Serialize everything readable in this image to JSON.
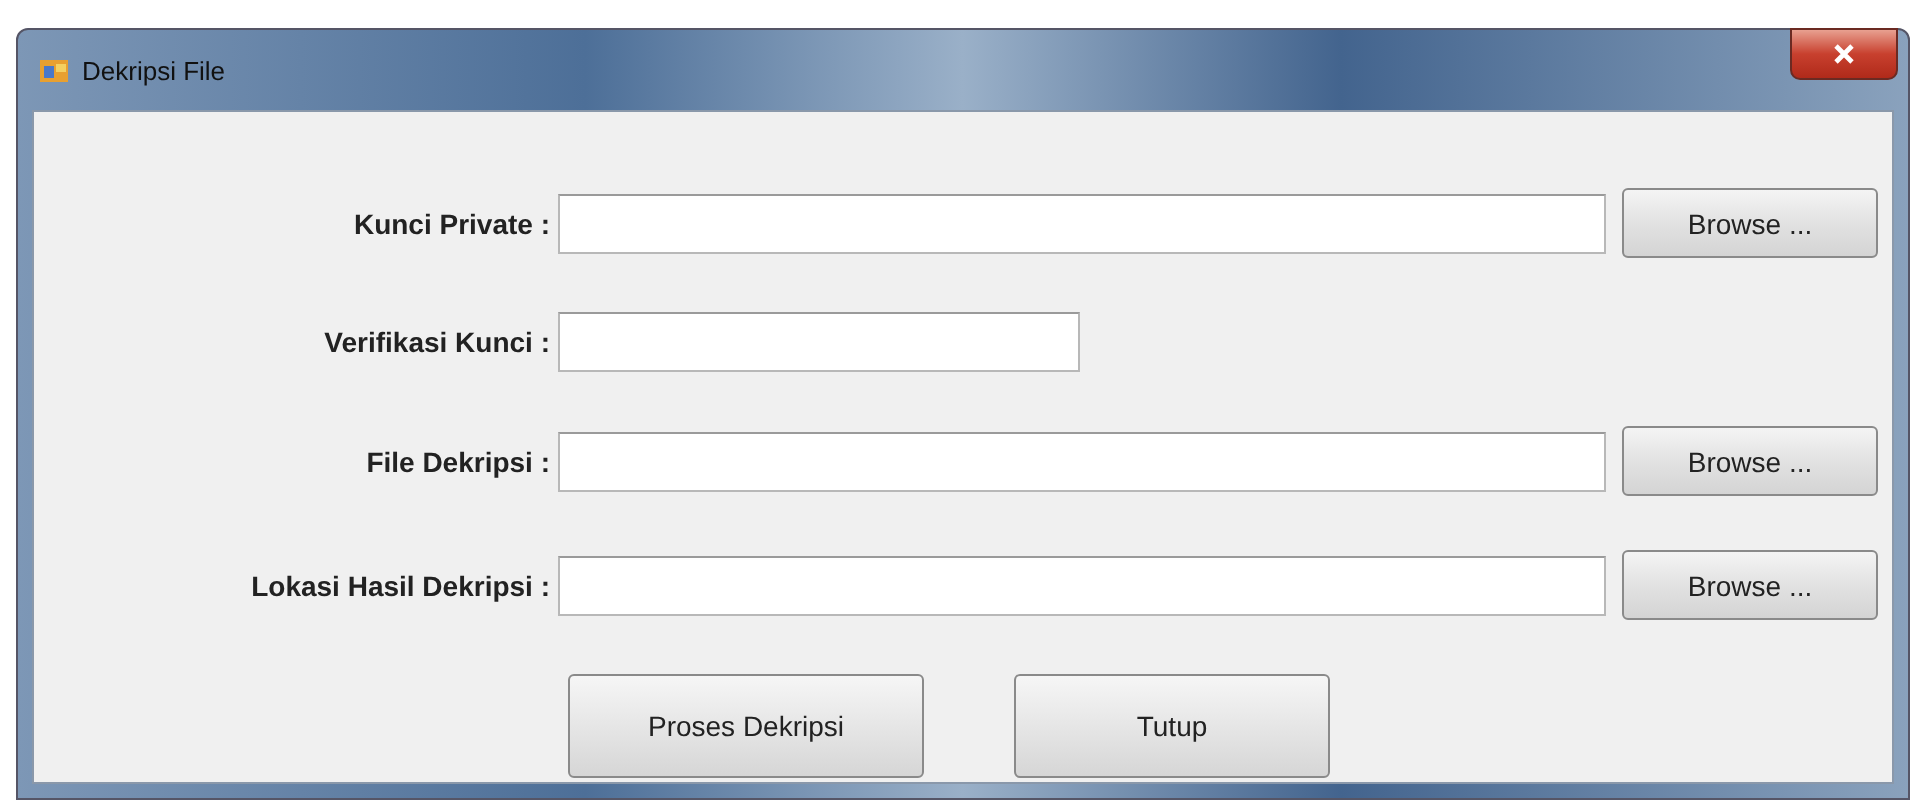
{
  "window": {
    "title": "Dekripsi File"
  },
  "rows": [
    {
      "kind": "path",
      "label": "Kunci Private :",
      "button": "Browse ..."
    },
    {
      "kind": "text",
      "label": "Verifikasi Kunci :"
    },
    {
      "kind": "path",
      "label": "File Dekripsi :",
      "button": "Browse ..."
    },
    {
      "kind": "path",
      "label": "Lokasi Hasil Dekripsi :",
      "button": "Browse ..."
    }
  ],
  "buttons": [
    "Proses Dekripsi",
    "Tutup"
  ]
}
